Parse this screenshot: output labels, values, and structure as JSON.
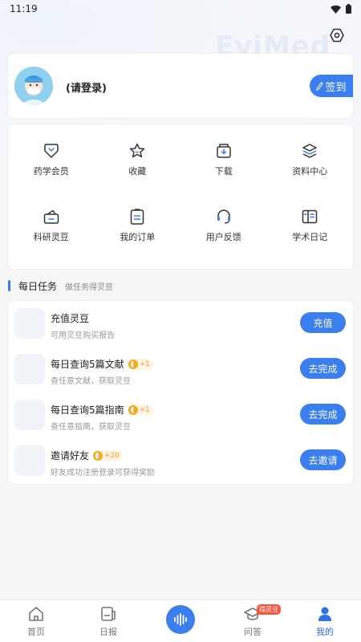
{
  "status_bar": {
    "time": "11:19"
  },
  "watermark": "EviMed",
  "profile": {
    "login_text": "(请登录)",
    "checkin_label": "签到"
  },
  "grid": [
    {
      "label": "药学会员",
      "icon": "vip-heart-icon"
    },
    {
      "label": "收藏",
      "icon": "star-icon"
    },
    {
      "label": "下载",
      "icon": "download-icon"
    },
    {
      "label": "资料中心",
      "icon": "layers-icon"
    },
    {
      "label": "科研灵豆",
      "icon": "wallet-icon"
    },
    {
      "label": "我的订单",
      "icon": "order-icon"
    },
    {
      "label": "用户反馈",
      "icon": "headset-icon"
    },
    {
      "label": "学术日记",
      "icon": "diary-icon"
    }
  ],
  "daily_tasks": {
    "title": "每日任务",
    "subtitle": "做任务得灵豆",
    "items": [
      {
        "title": "充值灵豆",
        "reward": "",
        "desc": "可用灵豆购买报告",
        "button": "充值"
      },
      {
        "title": "每日查询5篇文献",
        "reward": "+1",
        "desc": "查任意文献，获取灵豆",
        "button": "去完成"
      },
      {
        "title": "每日查询5篇指南",
        "reward": "+1",
        "desc": "查任意指南，获取灵豆",
        "button": "去完成"
      },
      {
        "title": "邀请好友",
        "reward": "+20",
        "desc": "好友成功注册登录可获得奖励",
        "button": "去邀请"
      }
    ]
  },
  "tabbar": {
    "home": "首页",
    "daily": "日报",
    "qa": "问答",
    "qa_badge": "得灵豆",
    "mine": "我的"
  },
  "colors": {
    "accent": "#3b7ef0",
    "reward": "#f7a823",
    "badge": "#f35b41"
  }
}
